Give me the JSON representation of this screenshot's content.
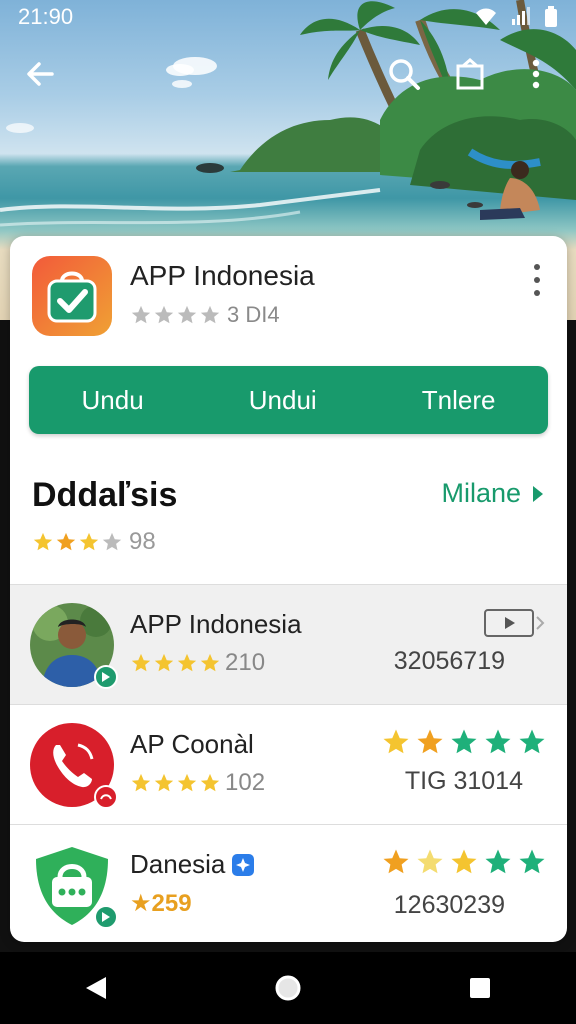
{
  "status_bar": {
    "time": "21:90"
  },
  "toolbar": {
    "icons": [
      "back-arrow-icon",
      "search-icon",
      "share-icon",
      "more-icon"
    ]
  },
  "app": {
    "title": "APP Indonesia",
    "rating_text": "3 DI4",
    "rating_stars": 4,
    "icon": "shopping-bag-check-icon",
    "colors": {
      "icon_start": "#f25a3a",
      "icon_end": "#f0a134",
      "check_bg": "#1f9b6e"
    }
  },
  "actions": {
    "buttons": [
      "Undu",
      "Undui",
      "Tnlere"
    ],
    "bar_color": "#189a6c"
  },
  "section": {
    "title": "Dddaľsis",
    "link": "Milane",
    "rating_text": "98",
    "rating_stars": 3
  },
  "list": [
    {
      "title": "APP Indonesia",
      "rating_text": "210",
      "right_text": "32056719",
      "right_icon": "video-icon",
      "avatar": "person-avatar",
      "badge_color": "#1f9b6e"
    },
    {
      "title": "AP Coonàl",
      "rating_text": "102",
      "right_text": "TIG 31014",
      "right_stars": "5 (2 gold, 3 green)",
      "avatar": "phone-icon",
      "badge_color": "#d81f2b"
    },
    {
      "title": "Danesia",
      "rating_text": "★259",
      "right_text": "12630239",
      "right_stars": "5 (3 gold, 2 green)",
      "avatar": "lock-shield-icon",
      "badge_color": "#1f9b6e",
      "verified_icon": "verified-badge-icon"
    }
  ],
  "navbar": {
    "icons": [
      "back-triangle-icon",
      "home-circle-icon",
      "recents-square-icon"
    ]
  }
}
